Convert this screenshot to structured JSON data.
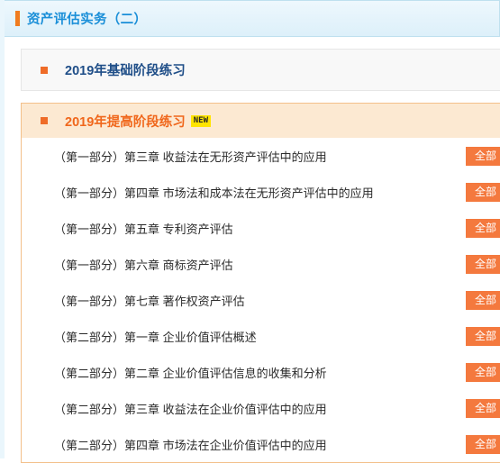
{
  "header": {
    "course_title": "资产评估实务（二）",
    "accent_color": "#f07c1f",
    "title_color": "#1a8fd8"
  },
  "sections": [
    {
      "id": "basic-stage",
      "title": "2019年基础阶段练习",
      "expanded": false,
      "badge": null,
      "title_color": "#1f4e88",
      "bullet_color": "#ef6c28",
      "chapters": []
    },
    {
      "id": "advanced-stage",
      "title": "2019年提高阶段练习",
      "expanded": true,
      "badge": "NEW",
      "title_color": "#f0671c",
      "bullet_color": "#ef6c28",
      "chapters": [
        {
          "label": "（第一部分）第三章  收益法在无形资产评估中的应用",
          "action": "全部"
        },
        {
          "label": "（第一部分）第四章   市场法和成本法在无形资产评估中的应用",
          "action": "全部"
        },
        {
          "label": "（第一部分）第五章   专利资产评估",
          "action": "全部"
        },
        {
          "label": "（第一部分）第六章   商标资产评估",
          "action": "全部"
        },
        {
          "label": "（第一部分）第七章   著作权资产评估",
          "action": "全部"
        },
        {
          "label": "（第二部分）第一章  企业价值评估概述",
          "action": "全部"
        },
        {
          "label": "（第二部分）第二章  企业价值评估信息的收集和分析",
          "action": "全部"
        },
        {
          "label": "（第二部分）第三章  收益法在企业价值评估中的应用",
          "action": "全部"
        },
        {
          "label": "（第二部分）第四章  市场法在企业价值评估中的应用",
          "action": "全部"
        }
      ]
    }
  ],
  "colors": {
    "button_bg": "#f4793e",
    "button_text": "#ffffff",
    "badge_bg": "#ffe400",
    "badge_text": "#262626",
    "expanded_head_bg": "#fce9d2",
    "expanded_border": "#f3c08a",
    "collapsed_bg": "#f8f8f8",
    "collapsed_border": "#e6e6e6",
    "header_border": "#bfe0ef"
  }
}
